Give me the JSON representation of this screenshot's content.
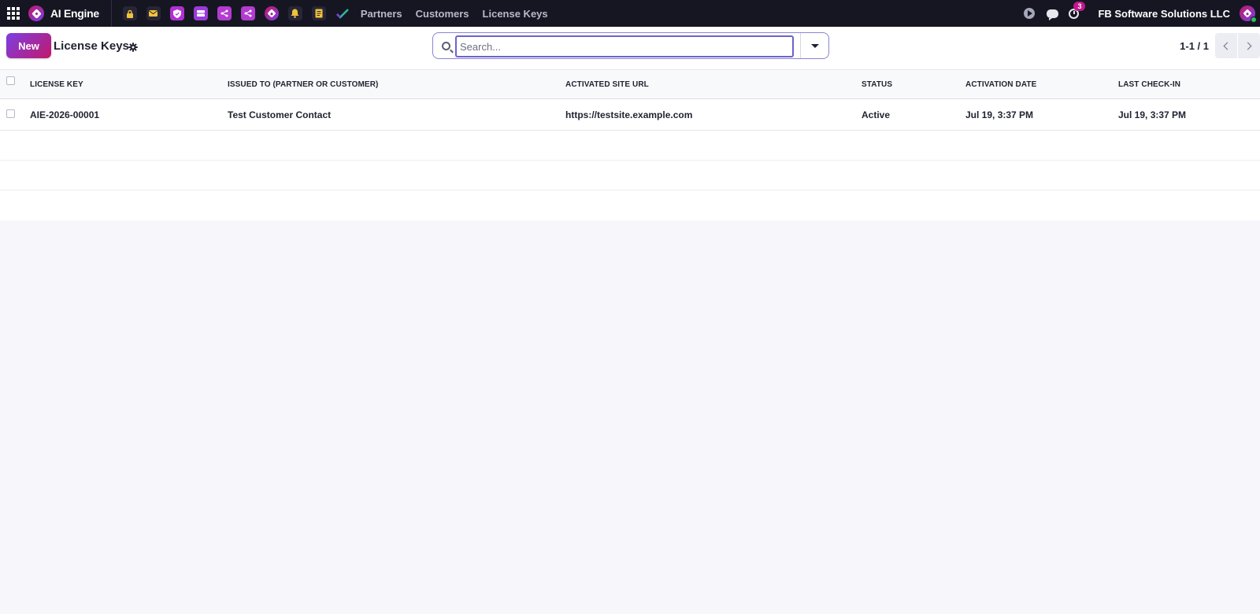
{
  "navbar": {
    "brand": "AI Engine",
    "links": [
      "Partners",
      "Customers",
      "License Keys"
    ],
    "notification_count": "3",
    "company": "FB Software Solutions LLC",
    "quick_icons": [
      "lock-icon",
      "mail-icon",
      "shield-icon",
      "server-icon",
      "share-icon",
      "share-icon",
      "diamond-logo-icon",
      "bell-icon",
      "note-icon",
      "check-icon"
    ]
  },
  "control_panel": {
    "new_label": "New",
    "title": "License Keys",
    "search_placeholder": "Search...",
    "pager": "1-1 / 1"
  },
  "table": {
    "columns": [
      "LICENSE KEY",
      "ISSUED TO (PARTNER OR CUSTOMER)",
      "ACTIVATED SITE URL",
      "STATUS",
      "ACTIVATION DATE",
      "LAST CHECK-IN"
    ],
    "rows": [
      {
        "license_key": "AIE-2026-00001",
        "issued_to": "Test Customer Contact",
        "site_url": "https://testsite.example.com",
        "status": "Active",
        "activation_date": "Jul 19, 3:37 PM",
        "last_checkin": "Jul 19, 3:37 PM"
      }
    ]
  },
  "colors": {
    "navbar_bg": "#161622",
    "accent_purple": "#7b3fe4",
    "accent_magenta": "#c2186b",
    "page_bg": "#f7f7fb"
  }
}
